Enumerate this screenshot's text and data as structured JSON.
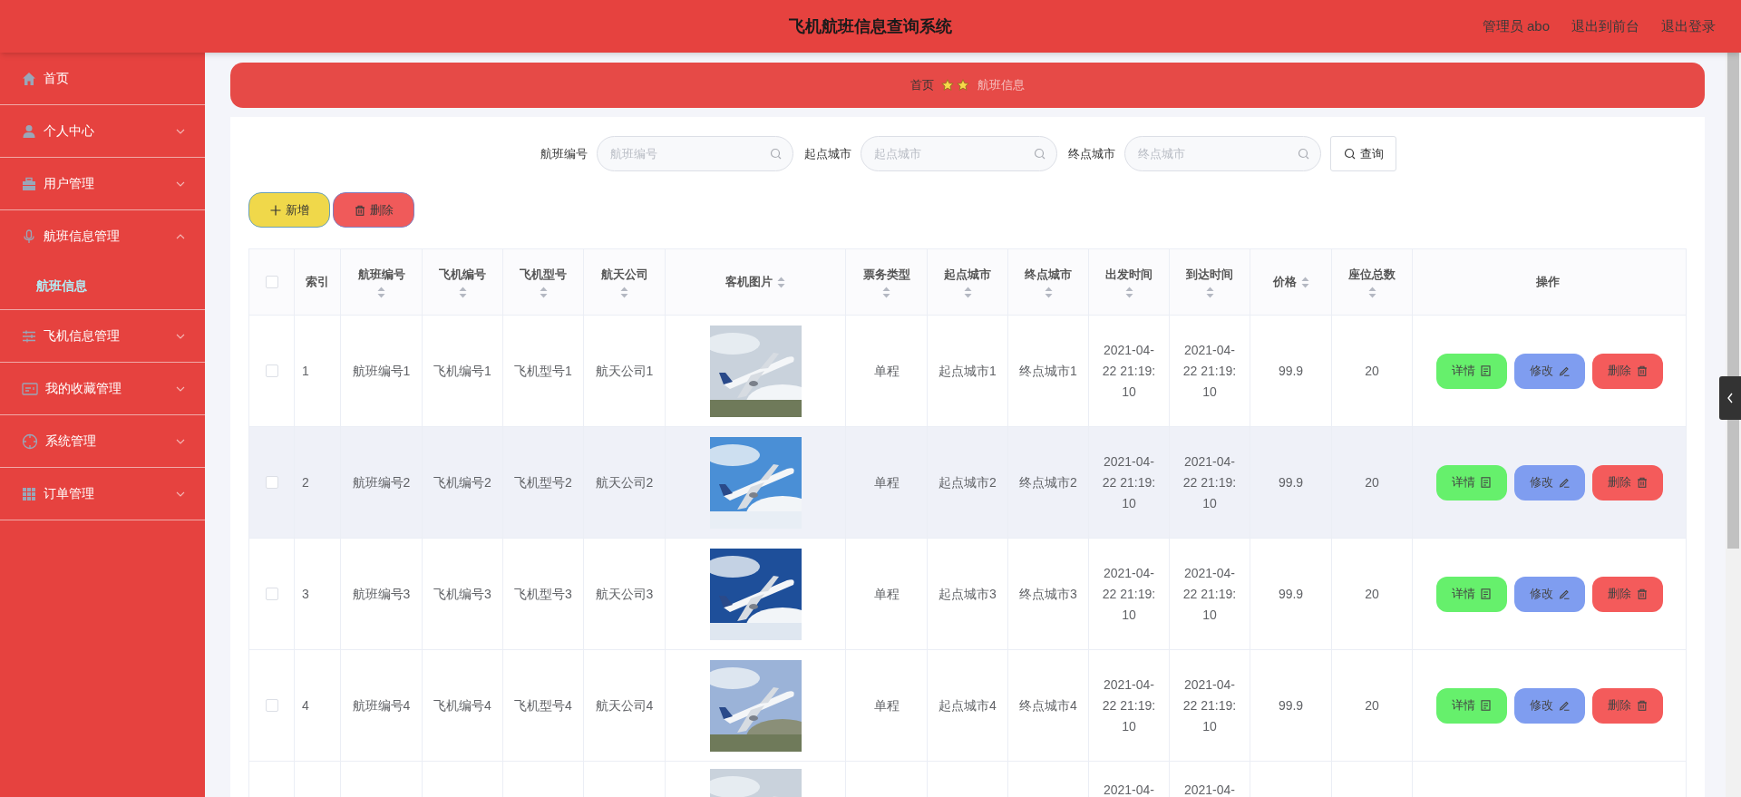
{
  "header": {
    "title": "飞机航班信息查询系统",
    "links": [
      "管理员 abo",
      "退出到前台",
      "退出登录"
    ]
  },
  "sidebar": {
    "items": [
      {
        "label": "首页"
      },
      {
        "label": "个人中心",
        "expanded": false
      },
      {
        "label": "用户管理",
        "expanded": false
      },
      {
        "label": "航班信息管理",
        "expanded": true,
        "children": [
          {
            "label": "航班信息",
            "selected": true
          }
        ]
      },
      {
        "label": "飞机信息管理",
        "expanded": false
      },
      {
        "label": "我的收藏管理",
        "expanded": false
      },
      {
        "label": "系统管理",
        "expanded": false
      },
      {
        "label": "订单管理",
        "expanded": false
      }
    ]
  },
  "breadcrumb": {
    "home": "首页",
    "current": "航班信息"
  },
  "search": {
    "fields": [
      {
        "label": "航班编号",
        "placeholder": "航班编号"
      },
      {
        "label": "起点城市",
        "placeholder": "起点城市"
      },
      {
        "label": "终点城市",
        "placeholder": "终点城市"
      }
    ],
    "button": "查询"
  },
  "actions": {
    "add": "新增",
    "delete": "删除"
  },
  "table": {
    "select_all_checked": false,
    "columns": [
      {
        "label": "索引",
        "sortable": false
      },
      {
        "label": "航班编号",
        "sortable": true
      },
      {
        "label": "飞机编号",
        "sortable": true
      },
      {
        "label": "飞机型号",
        "sortable": true
      },
      {
        "label": "航天公司",
        "sortable": true
      },
      {
        "label": "客机图片",
        "sortable": true
      },
      {
        "label": "票务类型",
        "sortable": true
      },
      {
        "label": "起点城市",
        "sortable": true
      },
      {
        "label": "终点城市",
        "sortable": true
      },
      {
        "label": "出发时间",
        "sortable": true
      },
      {
        "label": "到达时间",
        "sortable": true
      },
      {
        "label": "价格",
        "sortable": true
      },
      {
        "label": "座位总数",
        "sortable": true
      },
      {
        "label": "操作",
        "sortable": false
      }
    ],
    "rows": [
      {
        "kind": "full",
        "checked": false,
        "highlighted": false,
        "cells": [
          "1",
          "航班编号1",
          "飞机编号1",
          "飞机型号1",
          "航天公司1",
          {
            "kind": "picture"
          },
          "单程",
          "起点城市1",
          "终点城市1",
          "2021-04-22 21:19:10",
          "2021-04-22 21:19:10",
          "99.9",
          "20"
        ],
        "buttons": [
          "详情",
          "修改",
          "删除"
        ]
      },
      {
        "kind": "full",
        "checked": false,
        "highlighted": true,
        "cells": [
          "2",
          "航班编号2",
          "飞机编号2",
          "飞机型号2",
          "航天公司2",
          {
            "kind": "picture"
          },
          "单程",
          "起点城市2",
          "终点城市2",
          "2021-04-22 21:19:10",
          "2021-04-22 21:19:10",
          "99.9",
          "20"
        ],
        "buttons": [
          "详情",
          "修改",
          "删除"
        ]
      },
      {
        "kind": "full",
        "checked": false,
        "highlighted": false,
        "cells": [
          "3",
          "航班编号3",
          "飞机编号3",
          "飞机型号3",
          "航天公司3",
          {
            "kind": "picture"
          },
          "单程",
          "起点城市3",
          "终点城市3",
          "2021-04-22 21:19:10",
          "2021-04-22 21:19:10",
          "99.9",
          "20"
        ],
        "buttons": [
          "详情",
          "修改",
          "删除"
        ]
      },
      {
        "kind": "full",
        "checked": false,
        "highlighted": false,
        "cells": [
          "4",
          "航班编号4",
          "飞机编号4",
          "飞机型号4",
          "航天公司4",
          {
            "kind": "picture"
          },
          "单程",
          "起点城市4",
          "终点城市4",
          "2021-04-22 21:19:10",
          "2021-04-22 21:19:10",
          "99.9",
          "20"
        ],
        "buttons": [
          "详情",
          "修改",
          "删除"
        ]
      },
      {
        "kind": "partial",
        "cells": [
          "",
          "",
          "",
          "",
          "",
          {
            "kind": "picture"
          },
          "",
          "",
          "",
          "2021-04-",
          "2021-04-",
          "",
          ""
        ]
      }
    ]
  }
}
